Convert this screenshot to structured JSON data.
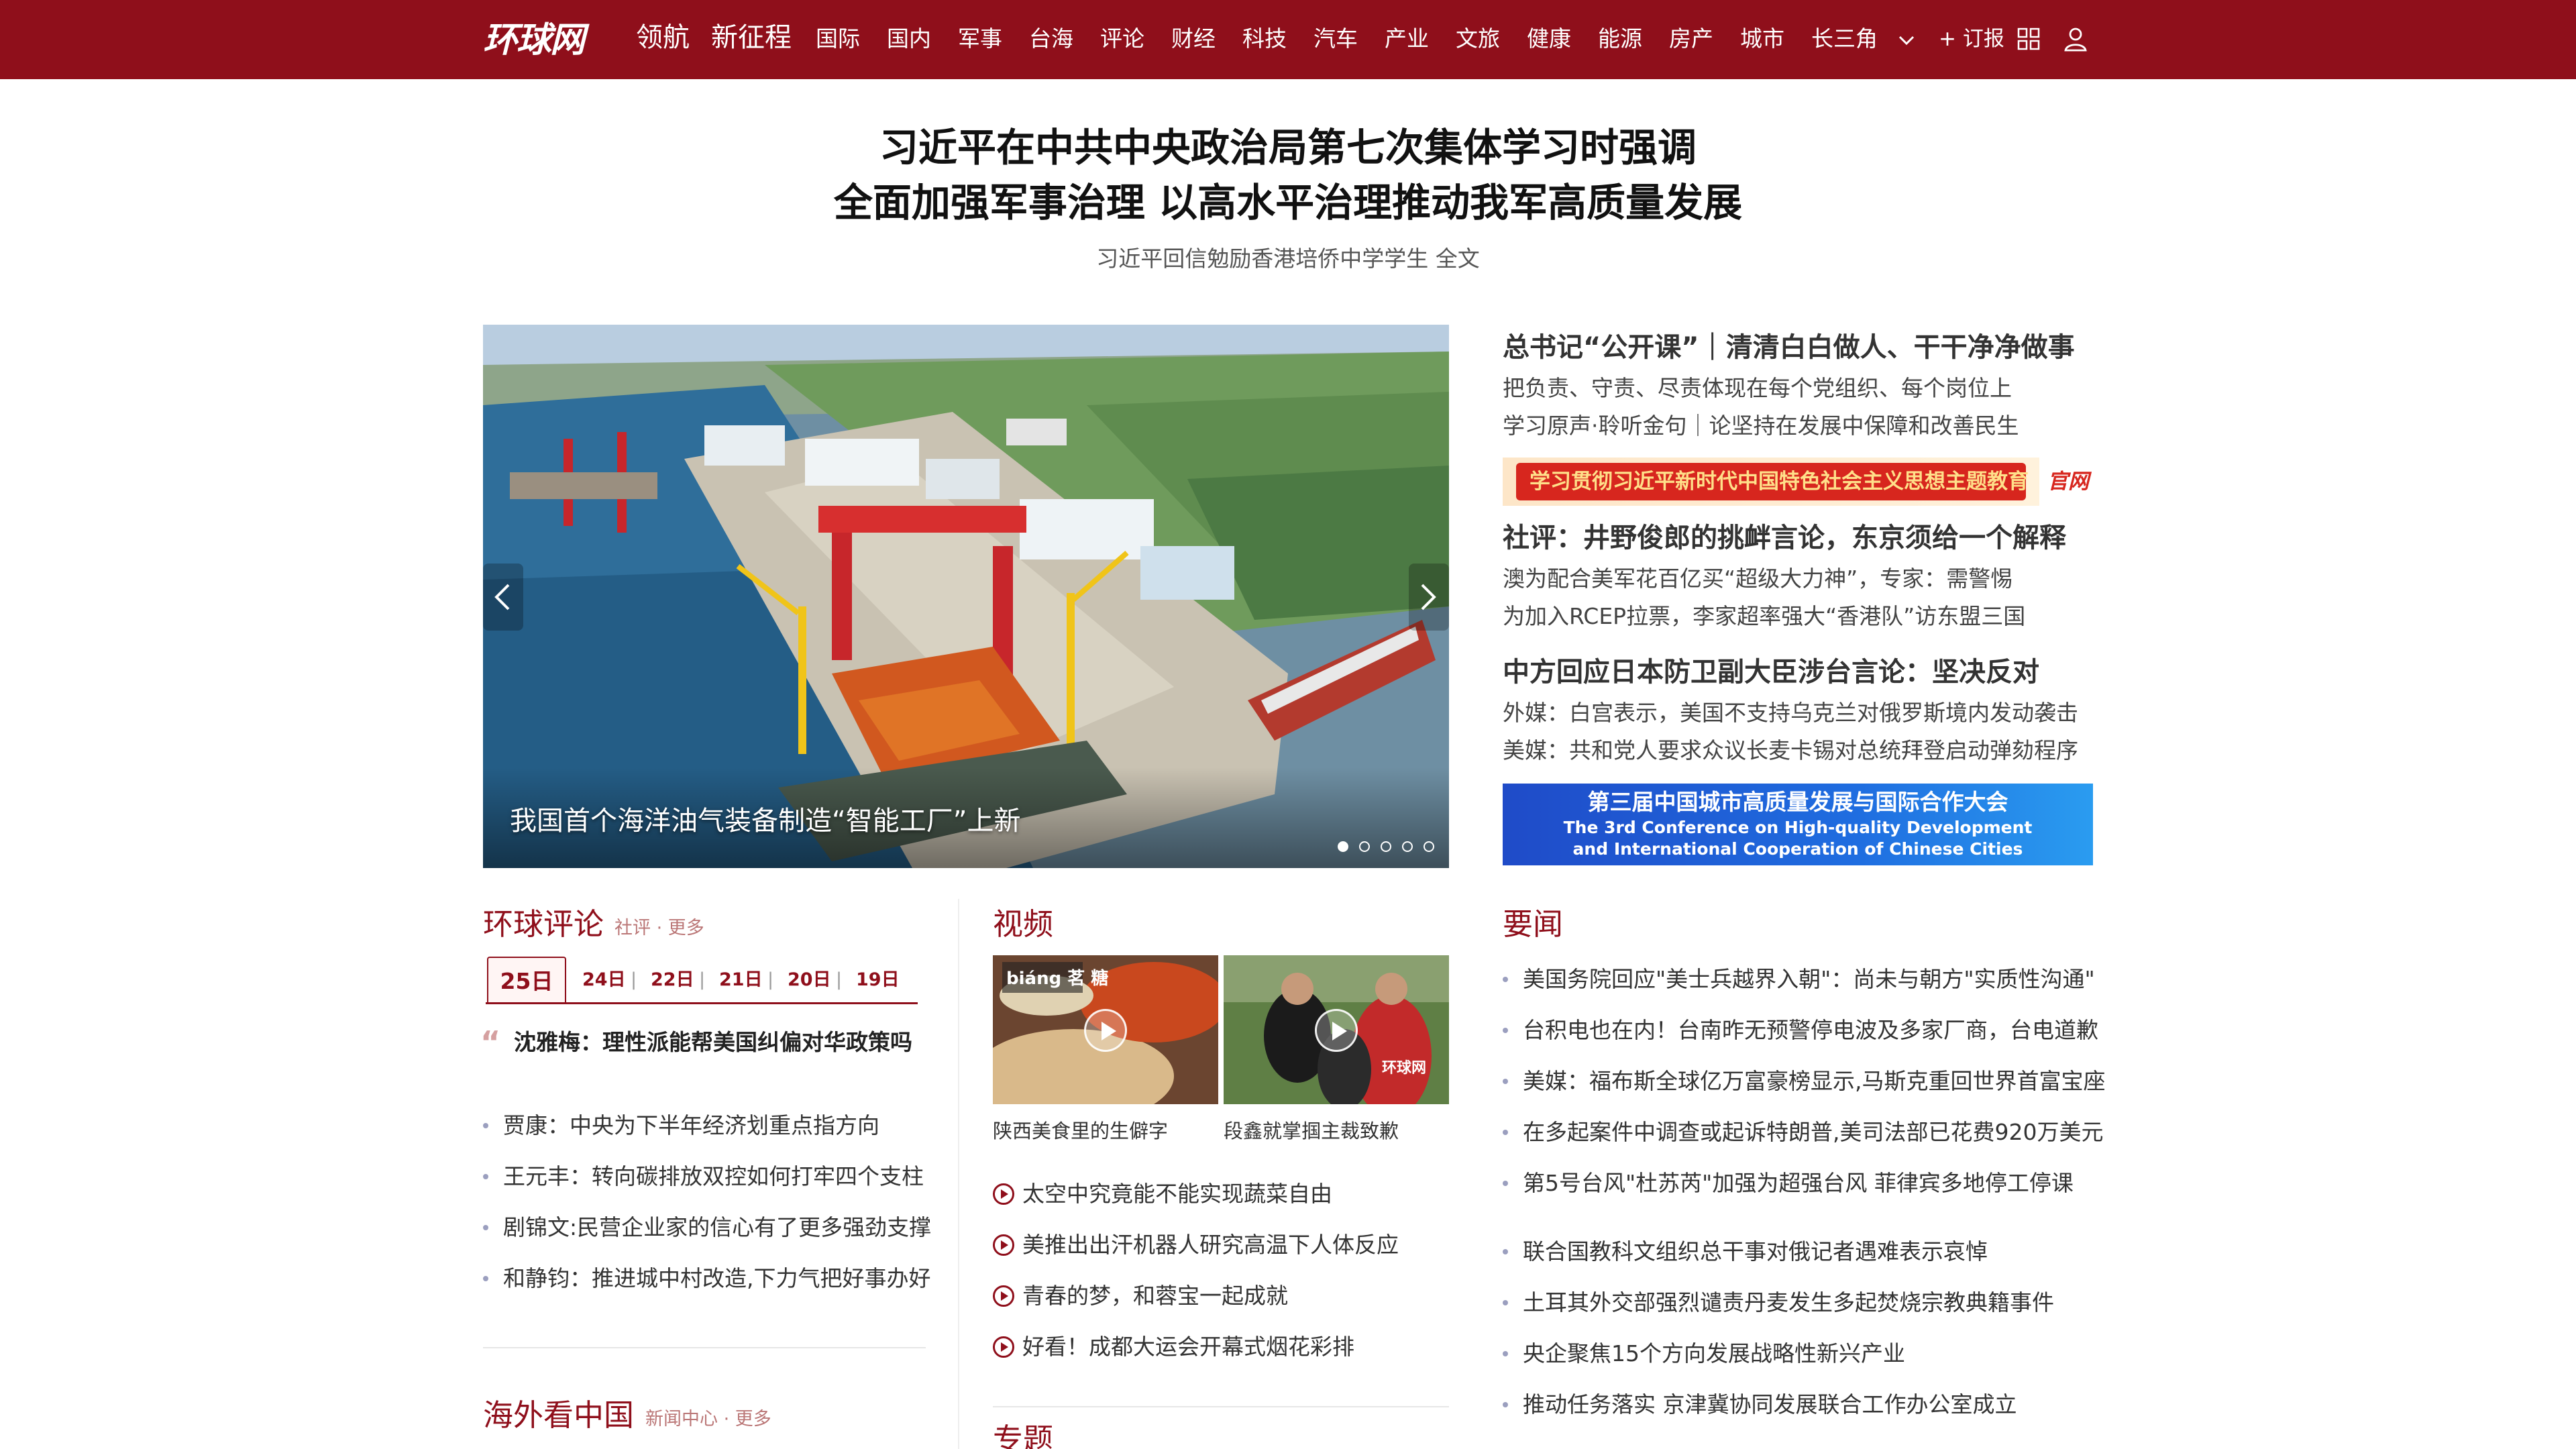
{
  "header": {
    "logo": "环球网",
    "nav_primary": [
      "领航",
      "新征程"
    ],
    "nav_items": [
      "国际",
      "国内",
      "军事",
      "台海",
      "评论",
      "财经",
      "科技",
      "汽车",
      "产业",
      "文旅",
      "健康",
      "能源",
      "房产",
      "城市",
      "长三角"
    ],
    "subscribe": "+ 订报",
    "icons": [
      "chevron-down-icon",
      "grid-icon",
      "user-icon"
    ]
  },
  "headline": {
    "line1": "习近平在中共中央政治局第七次集体学习时强调",
    "line2": "全面加强军事治理 以高水平治理推动我军高质量发展",
    "sub": "习近平回信勉励香港培侨中学学生 全文"
  },
  "carousel": {
    "caption": "我国首个海洋油气装备制造“智能工厂”上新",
    "slide_count": 5,
    "active_index": 0
  },
  "right_column": {
    "block1_title": "总书记“公开课”｜清清白白做人、干干净净做事",
    "block1_lines": [
      "把负责、守责、尽责体现在每个党组织、每个岗位上",
      "学习原声·聆听金句｜论坚持在发展中保障和改善民生"
    ],
    "banner1_text": "学习贯彻习近平新时代中国特色社会主义思想主题教育",
    "banner1_tag": "官网",
    "block2_title": "社评：井野俊郎的挑衅言论，东京须给一个解释",
    "block2_lines": [
      "澳为配合美军花百亿买“超级大力神”，专家：需警惕",
      "为加入RCEP拉票，李家超率强大“香港队”访东盟三国"
    ],
    "block3_title": "中方回应日本防卫副大臣涉台言论：坚决反对",
    "block3_lines": [
      "外媒：白宫表示，美国不支持乌克兰对俄罗斯境内发动袭击",
      "美媒：共和党人要求众议长麦卡锡对总统拜登启动弹劾程序"
    ],
    "banner2_cn": "第三届中国城市高质量发展与国际合作大会",
    "banner2_en1": "The 3rd Conference on High-quality Development",
    "banner2_en2": "and International Cooperation of Chinese Cities"
  },
  "commentary": {
    "title": "环球评论",
    "links": "社评 · 更多",
    "dates": [
      "25日",
      "24日",
      "22日",
      "21日",
      "20日",
      "19日"
    ],
    "featured": "沈雅梅：理性派能帮美国纠偏对华政策吗",
    "items": [
      "贾康：中央为下半年经济划重点指方向",
      "王元丰：转向碳排放双控如何打牢四个支柱",
      "剧锦文:民营企业家的信心有了更多强劲支撑",
      "和静钧：推进城中村改造,下力气把好事办好"
    ]
  },
  "overseas": {
    "title": "海外看中国",
    "links": "新闻中心 · 更多"
  },
  "video": {
    "title": "视频",
    "thumbs": [
      {
        "caption": "陕西美食里的生僻字",
        "overlay": "biáng 茗 糖"
      },
      {
        "caption": "段鑫就掌掴主裁致歉",
        "overlay": "环球网"
      }
    ],
    "items": [
      "太空中究竟能不能实现蔬菜自由",
      "美推出出汗机器人研究高温下人体反应",
      "青春的梦，和蓉宝一起成就",
      "好看！成都大运会开幕式烟花彩排"
    ],
    "next_section": "专题"
  },
  "news": {
    "title": "要闻",
    "group1": [
      "美国务院回应\"美士兵越界入朝\"：尚未与朝方\"实质性沟通\"",
      "台积电也在内！台南昨无预警停电波及多家厂商，台电道歉",
      "美媒：福布斯全球亿万富豪榜显示,马斯克重回世界首富宝座",
      "在多起案件中调查或起诉特朗普,美司法部已花费920万美元",
      "第5号台风\"杜苏芮\"加强为超强台风 菲律宾多地停工停课"
    ],
    "group2": [
      "联合国教科文组织总干事对俄记者遇难表示哀悼",
      "土耳其外交部强烈谴责丹麦发生多起焚烧宗教典籍事件",
      "央企聚焦15个方向发展战略性新兴产业",
      "推动任务落实 京津冀协同发展联合工作办公室成立"
    ]
  },
  "colors": {
    "brand": "#8f0f1b",
    "bullet": "#9b9fbf",
    "banner_blue": "#1f5cd6"
  }
}
